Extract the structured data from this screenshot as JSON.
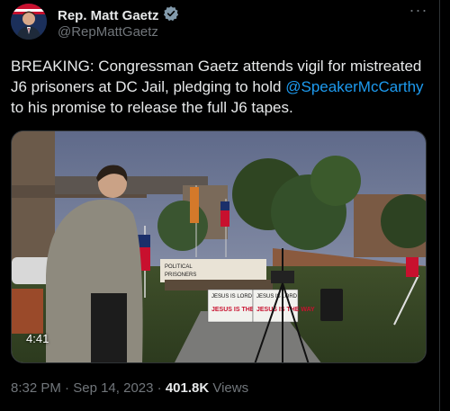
{
  "author": {
    "name": "Rep. Matt Gaetz",
    "handle": "@RepMattGaetz",
    "verified": true
  },
  "post": {
    "text_before_mention": "BREAKING: Congressman Gaetz attends vigil for mistreated J6 prisoners at DC Jail, pledging to hold ",
    "mention": "@SpeakerMcCarthy",
    "text_after_mention": " to his promise to release the full J6 tapes."
  },
  "media": {
    "duration": "4:41",
    "signs": {
      "sign_left_top": "JESUS IS LORD",
      "sign_left_bottom": "JESUS IS THE LIFE",
      "sign_right_top": "JESUS IS LORD",
      "sign_right_bottom": "JESUS IS THE WAY",
      "banner_left": "POLITICAL",
      "banner_left_2": "PRISONERS"
    }
  },
  "meta": {
    "time": "8:32 PM",
    "separator": "·",
    "date": "Sep 14, 2023",
    "views_count": "401.8K",
    "views_label": "Views"
  },
  "colors": {
    "background": "#000000",
    "text": "#e7e9ea",
    "secondary": "#71767b",
    "link": "#1d9bf0",
    "verified": "#829aab"
  },
  "icons": [
    "verified-badge-icon",
    "more-options-icon"
  ]
}
